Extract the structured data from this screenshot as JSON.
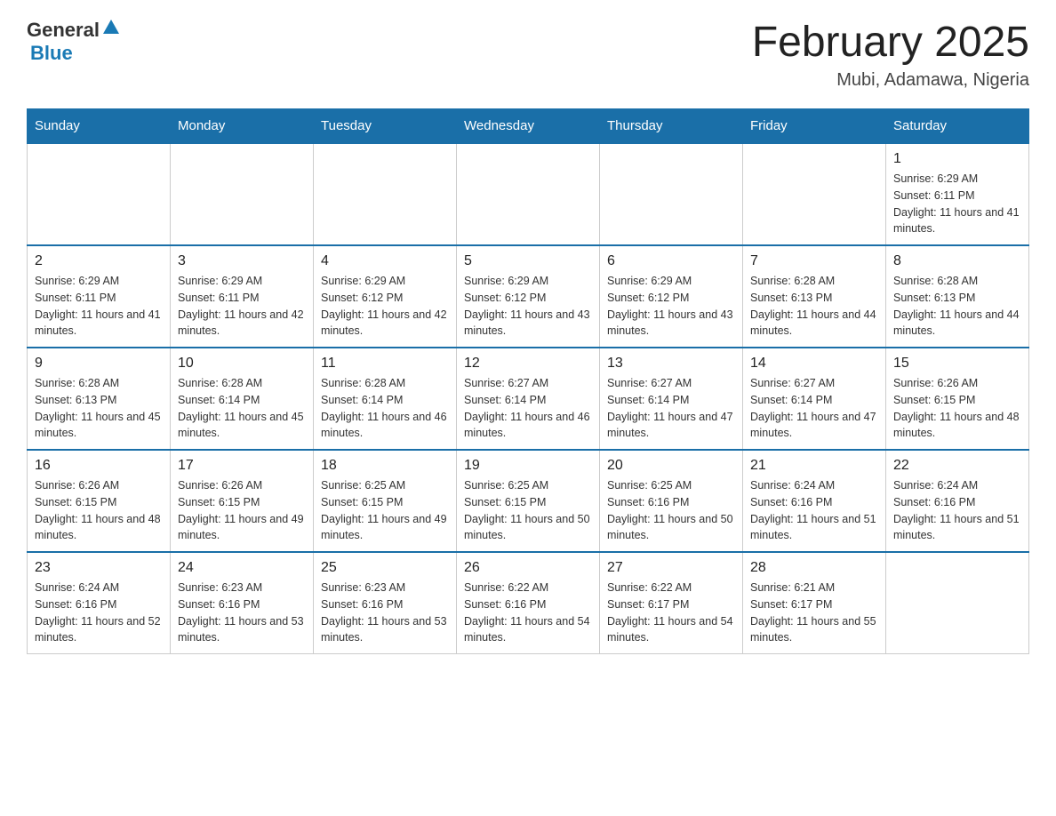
{
  "logo": {
    "general": "General",
    "blue": "Blue"
  },
  "title": "February 2025",
  "location": "Mubi, Adamawa, Nigeria",
  "days_of_week": [
    "Sunday",
    "Monday",
    "Tuesday",
    "Wednesday",
    "Thursday",
    "Friday",
    "Saturday"
  ],
  "weeks": [
    [
      {
        "day": "",
        "info": ""
      },
      {
        "day": "",
        "info": ""
      },
      {
        "day": "",
        "info": ""
      },
      {
        "day": "",
        "info": ""
      },
      {
        "day": "",
        "info": ""
      },
      {
        "day": "",
        "info": ""
      },
      {
        "day": "1",
        "info": "Sunrise: 6:29 AM\nSunset: 6:11 PM\nDaylight: 11 hours and 41 minutes."
      }
    ],
    [
      {
        "day": "2",
        "info": "Sunrise: 6:29 AM\nSunset: 6:11 PM\nDaylight: 11 hours and 41 minutes."
      },
      {
        "day": "3",
        "info": "Sunrise: 6:29 AM\nSunset: 6:11 PM\nDaylight: 11 hours and 42 minutes."
      },
      {
        "day": "4",
        "info": "Sunrise: 6:29 AM\nSunset: 6:12 PM\nDaylight: 11 hours and 42 minutes."
      },
      {
        "day": "5",
        "info": "Sunrise: 6:29 AM\nSunset: 6:12 PM\nDaylight: 11 hours and 43 minutes."
      },
      {
        "day": "6",
        "info": "Sunrise: 6:29 AM\nSunset: 6:12 PM\nDaylight: 11 hours and 43 minutes."
      },
      {
        "day": "7",
        "info": "Sunrise: 6:28 AM\nSunset: 6:13 PM\nDaylight: 11 hours and 44 minutes."
      },
      {
        "day": "8",
        "info": "Sunrise: 6:28 AM\nSunset: 6:13 PM\nDaylight: 11 hours and 44 minutes."
      }
    ],
    [
      {
        "day": "9",
        "info": "Sunrise: 6:28 AM\nSunset: 6:13 PM\nDaylight: 11 hours and 45 minutes."
      },
      {
        "day": "10",
        "info": "Sunrise: 6:28 AM\nSunset: 6:14 PM\nDaylight: 11 hours and 45 minutes."
      },
      {
        "day": "11",
        "info": "Sunrise: 6:28 AM\nSunset: 6:14 PM\nDaylight: 11 hours and 46 minutes."
      },
      {
        "day": "12",
        "info": "Sunrise: 6:27 AM\nSunset: 6:14 PM\nDaylight: 11 hours and 46 minutes."
      },
      {
        "day": "13",
        "info": "Sunrise: 6:27 AM\nSunset: 6:14 PM\nDaylight: 11 hours and 47 minutes."
      },
      {
        "day": "14",
        "info": "Sunrise: 6:27 AM\nSunset: 6:14 PM\nDaylight: 11 hours and 47 minutes."
      },
      {
        "day": "15",
        "info": "Sunrise: 6:26 AM\nSunset: 6:15 PM\nDaylight: 11 hours and 48 minutes."
      }
    ],
    [
      {
        "day": "16",
        "info": "Sunrise: 6:26 AM\nSunset: 6:15 PM\nDaylight: 11 hours and 48 minutes."
      },
      {
        "day": "17",
        "info": "Sunrise: 6:26 AM\nSunset: 6:15 PM\nDaylight: 11 hours and 49 minutes."
      },
      {
        "day": "18",
        "info": "Sunrise: 6:25 AM\nSunset: 6:15 PM\nDaylight: 11 hours and 49 minutes."
      },
      {
        "day": "19",
        "info": "Sunrise: 6:25 AM\nSunset: 6:15 PM\nDaylight: 11 hours and 50 minutes."
      },
      {
        "day": "20",
        "info": "Sunrise: 6:25 AM\nSunset: 6:16 PM\nDaylight: 11 hours and 50 minutes."
      },
      {
        "day": "21",
        "info": "Sunrise: 6:24 AM\nSunset: 6:16 PM\nDaylight: 11 hours and 51 minutes."
      },
      {
        "day": "22",
        "info": "Sunrise: 6:24 AM\nSunset: 6:16 PM\nDaylight: 11 hours and 51 minutes."
      }
    ],
    [
      {
        "day": "23",
        "info": "Sunrise: 6:24 AM\nSunset: 6:16 PM\nDaylight: 11 hours and 52 minutes."
      },
      {
        "day": "24",
        "info": "Sunrise: 6:23 AM\nSunset: 6:16 PM\nDaylight: 11 hours and 53 minutes."
      },
      {
        "day": "25",
        "info": "Sunrise: 6:23 AM\nSunset: 6:16 PM\nDaylight: 11 hours and 53 minutes."
      },
      {
        "day": "26",
        "info": "Sunrise: 6:22 AM\nSunset: 6:16 PM\nDaylight: 11 hours and 54 minutes."
      },
      {
        "day": "27",
        "info": "Sunrise: 6:22 AM\nSunset: 6:17 PM\nDaylight: 11 hours and 54 minutes."
      },
      {
        "day": "28",
        "info": "Sunrise: 6:21 AM\nSunset: 6:17 PM\nDaylight: 11 hours and 55 minutes."
      },
      {
        "day": "",
        "info": ""
      }
    ]
  ]
}
